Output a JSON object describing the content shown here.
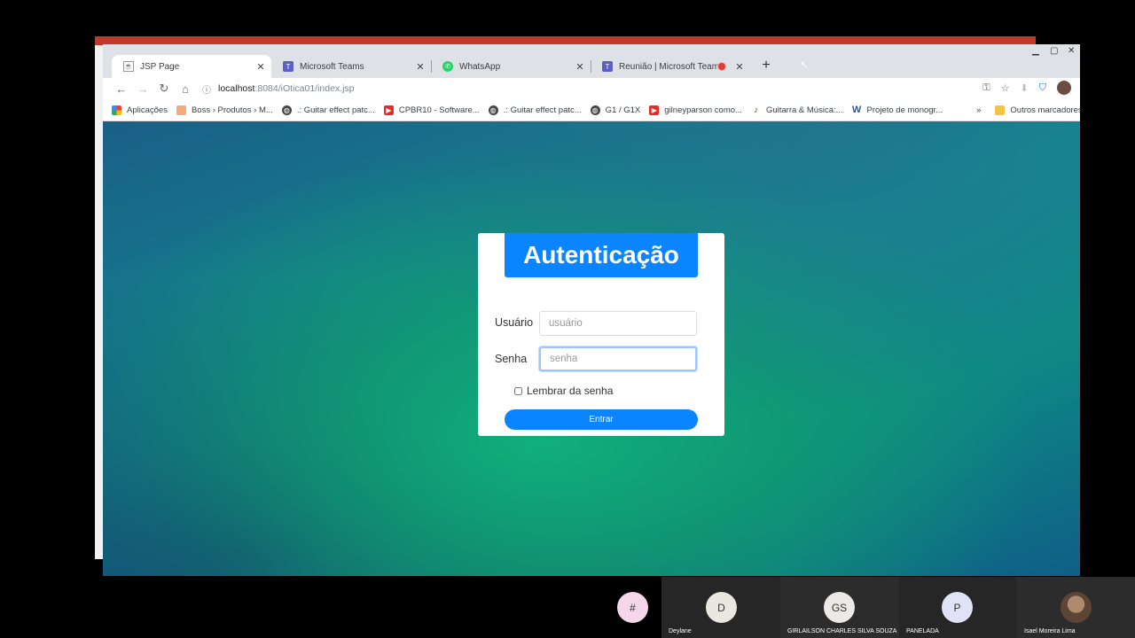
{
  "browser": {
    "tabs": [
      {
        "title": "JSP Page",
        "icon": "jsp-page-icon",
        "active": true
      },
      {
        "title": "Microsoft Teams",
        "icon": "teams-icon",
        "active": false
      },
      {
        "title": "WhatsApp",
        "icon": "whatsapp-icon",
        "active": false
      },
      {
        "title": "Reunião | Microsoft Teams",
        "icon": "teams-icon",
        "active": false,
        "recording": true
      }
    ],
    "url_host": "localhost",
    "url_path": ":8084/iOtica01/index.jsp",
    "bookmarks": [
      {
        "label": "Aplicações",
        "icon": "apps-grid-icon"
      },
      {
        "label": "Boss › Produtos › M...",
        "icon": "folder-icon"
      },
      {
        "label": ".: Guitar effect patc...",
        "icon": "globe-icon"
      },
      {
        "label": "CPBR10 - Software...",
        "icon": "youtube-icon"
      },
      {
        "label": ".: Guitar effect patc...",
        "icon": "globe-icon"
      },
      {
        "label": "G1 / G1X",
        "icon": "globe-icon"
      },
      {
        "label": "gilneyparson como...",
        "icon": "youtube-icon"
      },
      {
        "label": "Guitarra & Música:...",
        "icon": "guitar-icon"
      },
      {
        "label": "Projeto de monogr...",
        "icon": "word-w-icon"
      }
    ],
    "more_bookmarks_label": "»",
    "other_bookmarks_label": "Outros marcadores"
  },
  "login": {
    "title": "Autenticação",
    "user_label": "Usuário",
    "user_placeholder": "usuário",
    "password_label": "Senha",
    "password_placeholder": "senha",
    "remember_label": "Lembrar da senha",
    "submit_label": "Entrar"
  },
  "colors": {
    "primary": "#0a84ff",
    "tabbar": "#dee1e6",
    "record": "#e53935"
  },
  "participants": [
    {
      "initials": "#",
      "name": "",
      "color": "#f6d6ea"
    },
    {
      "initials": "D",
      "name": "Deylane",
      "color": "#e8e8e0"
    },
    {
      "initials": "GS",
      "name": "GIRLAILSON CHARLES SILVA SOUZA",
      "color": "#eceae4"
    },
    {
      "initials": "P",
      "name": "PANELADA",
      "color": "#dfe3f5"
    },
    {
      "initials": "",
      "name": "Isael Moreira Lima",
      "color": "#8a6a58"
    }
  ]
}
